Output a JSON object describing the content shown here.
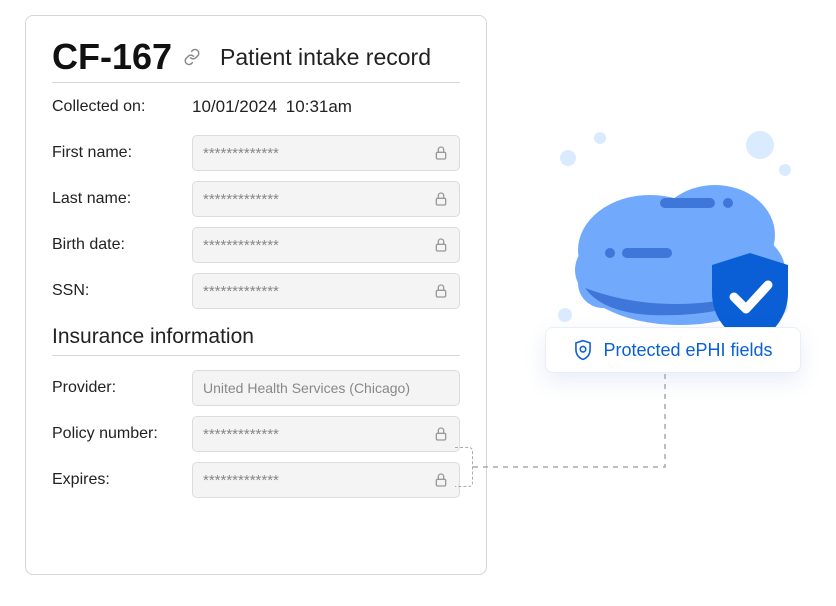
{
  "header": {
    "record_id": "CF-167",
    "title": "Patient intake record"
  },
  "collected": {
    "label": "Collected on:",
    "value": "10/01/2024  10:31am"
  },
  "fields": {
    "first_name": {
      "label": "First name:",
      "value": "*************"
    },
    "last_name": {
      "label": "Last name:",
      "value": "*************"
    },
    "birth_date": {
      "label": "Birth date:",
      "value": "*************"
    },
    "ssn": {
      "label": "SSN:",
      "value": "*************"
    }
  },
  "insurance": {
    "section_title": "Insurance information",
    "provider": {
      "label": "Provider:",
      "value": "United Health Services (Chicago)"
    },
    "policy": {
      "label": "Policy number:",
      "value": "*************"
    },
    "expires": {
      "label": "Expires:",
      "value": "*************"
    }
  },
  "badge": {
    "text": "Protected ePHI fields"
  }
}
